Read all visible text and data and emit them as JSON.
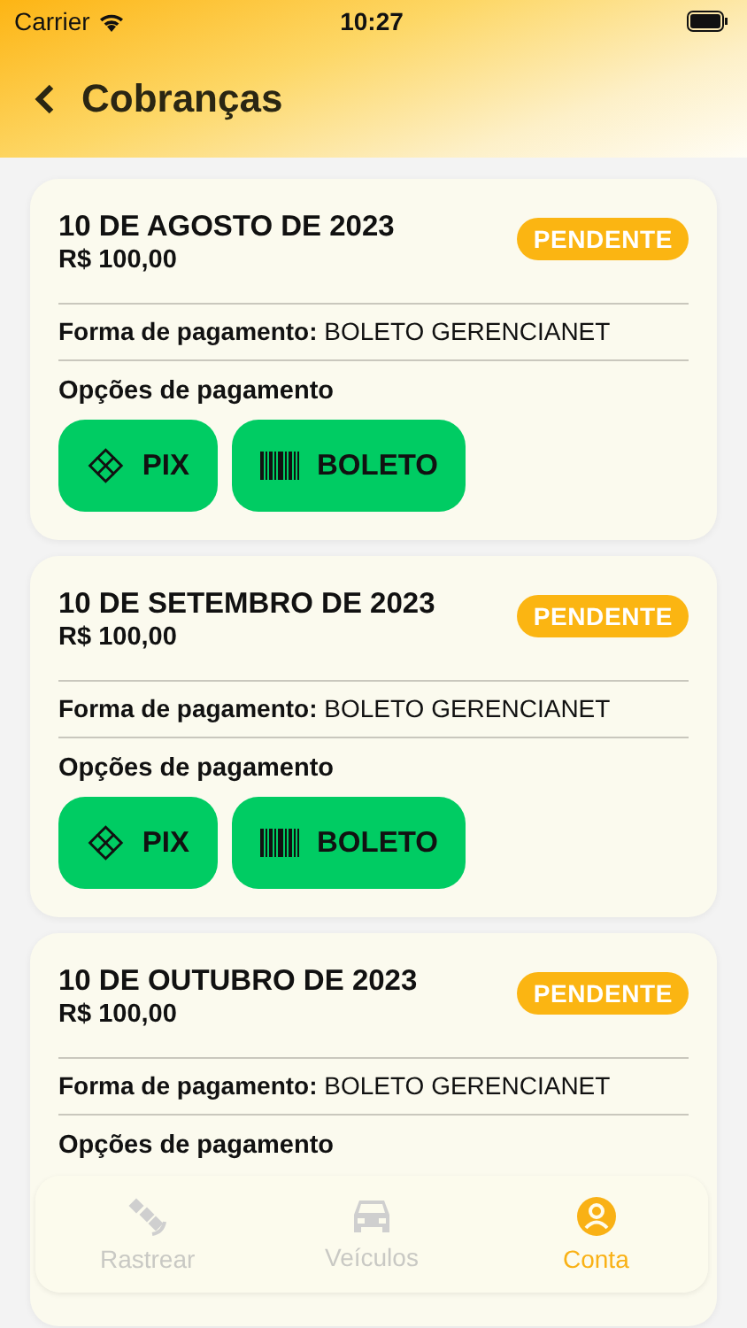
{
  "status_bar": {
    "carrier": "Carrier",
    "time": "10:27"
  },
  "header": {
    "title": "Cobranças"
  },
  "charges": [
    {
      "date": "10 DE AGOSTO DE 2023",
      "amount": "R$ 100,00",
      "status": "PENDENTE",
      "method_label": "Forma de pagamento:",
      "method": "BOLETO GERENCIANET",
      "options_title": "Opções de pagamento",
      "options": [
        {
          "kind": "pix",
          "label": "PIX"
        },
        {
          "kind": "boleto",
          "label": "BOLETO"
        }
      ]
    },
    {
      "date": "10 DE SETEMBRO DE 2023",
      "amount": "R$ 100,00",
      "status": "PENDENTE",
      "method_label": "Forma de pagamento:",
      "method": "BOLETO GERENCIANET",
      "options_title": "Opções de pagamento",
      "options": [
        {
          "kind": "pix",
          "label": "PIX"
        },
        {
          "kind": "boleto",
          "label": "BOLETO"
        }
      ]
    },
    {
      "date": "10 DE OUTUBRO DE 2023",
      "amount": "R$ 100,00",
      "status": "PENDENTE",
      "method_label": "Forma de pagamento:",
      "method": "BOLETO GERENCIANET",
      "options_title": "Opções de pagamento"
    }
  ],
  "tab_bar": [
    {
      "kind": "track",
      "label": "Rastrear",
      "selected": false
    },
    {
      "kind": "vehicles",
      "label": "Veículos",
      "selected": false
    },
    {
      "kind": "account",
      "label": "Conta",
      "selected": true
    }
  ]
}
